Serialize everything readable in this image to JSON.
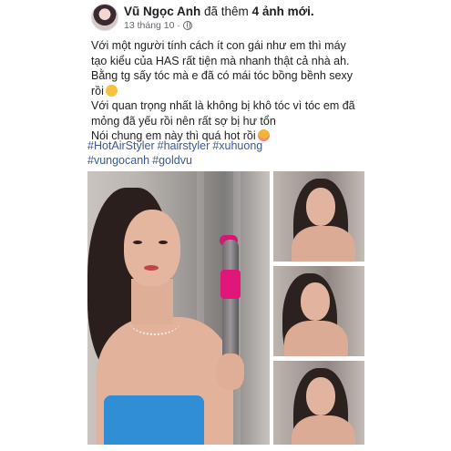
{
  "post": {
    "author": "Vũ Ngọc Anh",
    "action": "đã thêm",
    "photo_count": "4 ảnh mới.",
    "timestamp": "13 tháng 10 ·",
    "privacy_icon": "globe-icon",
    "paragraphs": [
      "Với một người tính cách ít con gái như em thì máy tạo kiểu của HAS rất tiện mà nhanh thật cả nhà ah. Bằng tg sấy tóc mà e đã có mái tóc bồng bềnh sexy rồi",
      "Với quan trọng nhất là không bị khô tóc vì tóc em đã mỏng đã yếu rồi nên rất sợ bị hư tổn",
      "Nói chung em này thì quá hot rồi"
    ],
    "emojis": [
      "grinning-sweat-emoji",
      "smiling-hearts-emoji"
    ],
    "hashtags": [
      "#HotAirStyler",
      "#hairstyler",
      "#xuhuong",
      "#vungocanh",
      "#goldvu"
    ]
  },
  "colors": {
    "text": "#1c1e21",
    "meta": "#65676b",
    "hashtag": "#385898",
    "dryer_accent": "#e0167a",
    "dress": "#2f8ed6"
  }
}
